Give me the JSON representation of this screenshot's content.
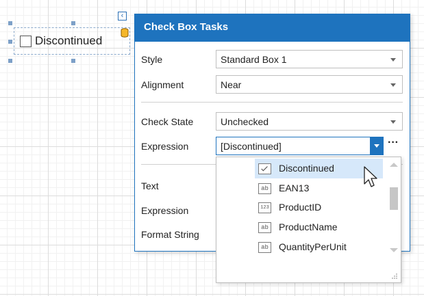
{
  "control": {
    "label": "Discontinued"
  },
  "panel": {
    "title": "Check Box Tasks",
    "rows": {
      "style": {
        "label": "Style",
        "value": "Standard Box 1"
      },
      "alignment": {
        "label": "Alignment",
        "value": "Near"
      },
      "check_state": {
        "label": "Check State",
        "value": "Unchecked"
      },
      "expression": {
        "label": "Expression",
        "value": "[Discontinued]",
        "more": "···"
      },
      "text": {
        "label": "Text"
      },
      "text_expression": {
        "label": "Expression"
      },
      "format_string": {
        "label": "Format String"
      }
    }
  },
  "dropdown": {
    "items": [
      {
        "label": "Discontinued",
        "icon": "checkbox-field-icon",
        "selected": true
      },
      {
        "label": "EAN13",
        "icon": "text-field-icon",
        "badge": "ab"
      },
      {
        "label": "ProductID",
        "icon": "numeric-field-icon",
        "badge": "123"
      },
      {
        "label": "ProductName",
        "icon": "text-field-icon",
        "badge": "ab"
      },
      {
        "label": "QuantityPerUnit",
        "icon": "text-field-icon",
        "badge": "ab"
      }
    ]
  },
  "colors": {
    "accent": "#1e73be",
    "selection": "#d6e8fa"
  }
}
